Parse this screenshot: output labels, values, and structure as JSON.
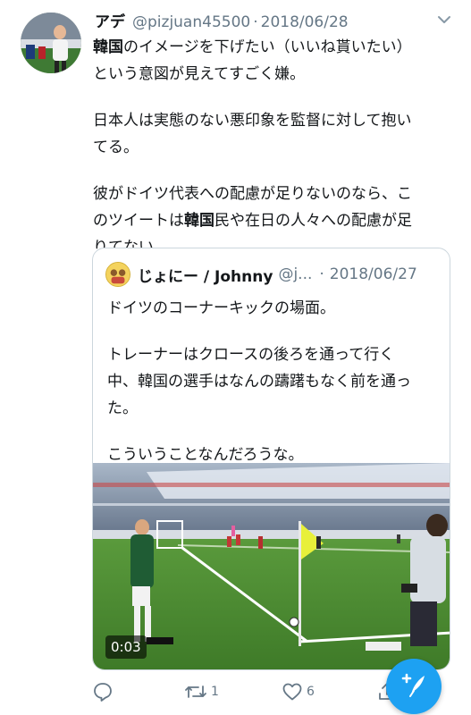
{
  "tweet": {
    "name": "アデ",
    "handle": "@pizjuan45500",
    "separator": "·",
    "date": "2018/06/28",
    "text_lines": [
      {
        "parts": [
          {
            "t": "韓国",
            "b": true
          },
          {
            "t": "のイメージを下げたい（いいね貰いたい）"
          }
        ]
      },
      {
        "parts": [
          {
            "t": "という意図が見えてすごく嫌。"
          }
        ]
      },
      {
        "gap": true
      },
      {
        "parts": [
          {
            "t": "日本人は実態のない悪印象を監督に対して抱い"
          }
        ]
      },
      {
        "parts": [
          {
            "t": "てる。"
          }
        ]
      },
      {
        "gap": true
      },
      {
        "parts": [
          {
            "t": "彼がドイツ代表への配慮が足りないのなら、こ"
          }
        ]
      },
      {
        "parts": [
          {
            "t": "のツイートは"
          },
          {
            "t": "韓国",
            "b": true
          },
          {
            "t": "民や在日の人々への配慮が足"
          }
        ]
      },
      {
        "parts": [
          {
            "t": "りてない。"
          }
        ]
      }
    ]
  },
  "quoted": {
    "name": "じょにー / Johnny",
    "handle": "@j...",
    "separator": "·",
    "date": "2018/06/27",
    "text_lines": [
      {
        "t": "ドイツのコーナーキックの場面。"
      },
      {
        "gap": true
      },
      {
        "t": "トレーナーはクロースの後ろを通って行く"
      },
      {
        "t": "中、韓国の選手はなんの躊躇もなく前を通っ"
      },
      {
        "t": "た。"
      },
      {
        "gap": true
      },
      {
        "t": "こういうことなんだろうな。"
      }
    ],
    "video_duration": "0:03"
  },
  "actions": {
    "reply_count": "",
    "retweet_count": "1",
    "like_count": "6"
  },
  "colors": {
    "accent": "#1da1f2",
    "secondary_text": "#657786",
    "border": "#ccd6dd"
  },
  "icons": {
    "more": "chevron-down-icon",
    "reply": "reply-icon",
    "retweet": "retweet-icon",
    "like": "heart-icon",
    "share": "share-icon",
    "compose": "compose-tweet-icon"
  }
}
